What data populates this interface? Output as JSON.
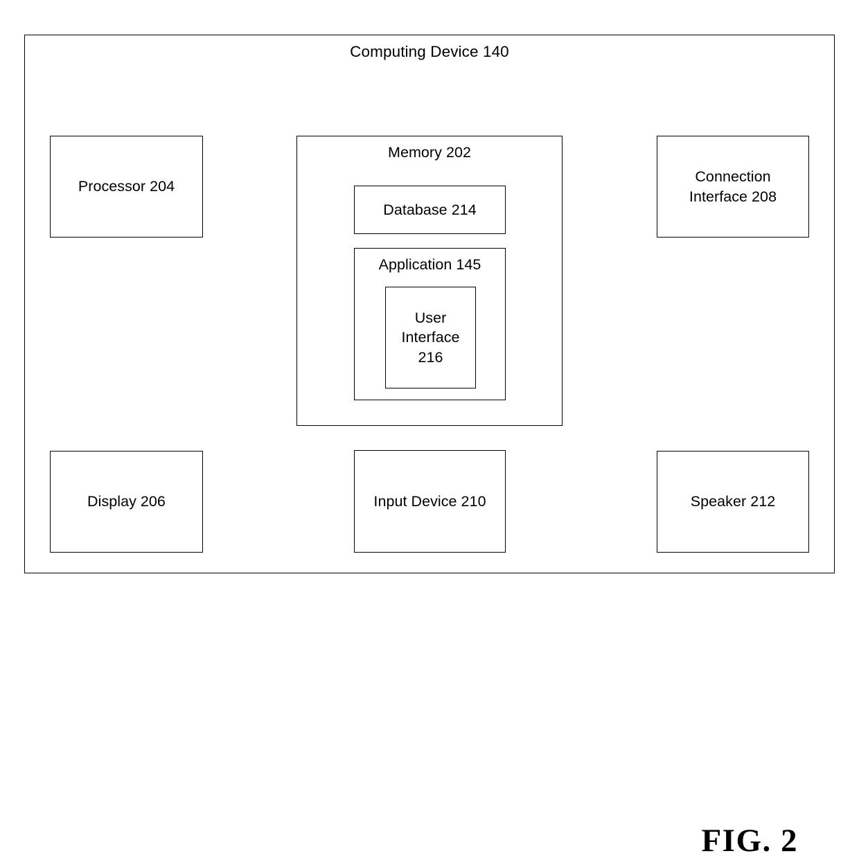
{
  "figure": {
    "caption": "FIG. 2"
  },
  "diagram": {
    "outer": {
      "title": "Computing Device 140"
    },
    "memory": {
      "title": "Memory 202",
      "database": {
        "label": "Database 214"
      },
      "application": {
        "title": "Application 145",
        "user_interface": {
          "label": "User\nInterface\n216"
        }
      }
    },
    "components": {
      "processor": "Processor 204",
      "connection_interface": "Connection\nInterface 208",
      "display": "Display 206",
      "input_device": "Input Device 210",
      "speaker": "Speaker 212"
    }
  },
  "style": {
    "line_color": "#000000",
    "background_color": "#ffffff"
  }
}
